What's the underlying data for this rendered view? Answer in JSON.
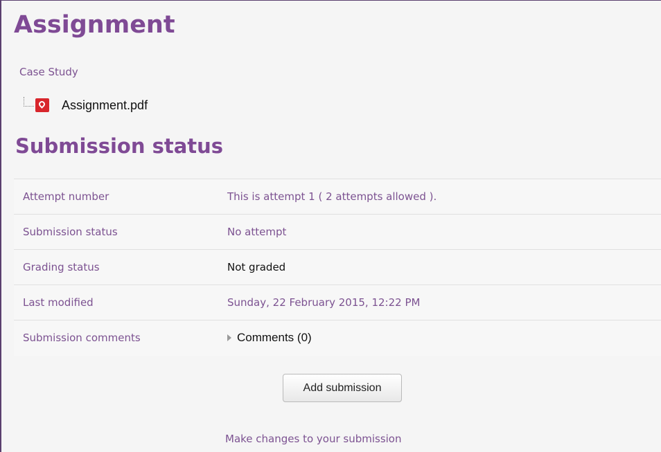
{
  "page": {
    "title": "Assignment",
    "intro": "Case Study",
    "attachment": {
      "filename": "Assignment.pdf",
      "icon": "pdf-icon"
    }
  },
  "submission_status": {
    "title": "Submission status",
    "rows": [
      {
        "label": "Attempt number",
        "value": "This is attempt 1 ( 2 attempts allowed )."
      },
      {
        "label": "Submission status",
        "value": "No attempt"
      },
      {
        "label": "Grading status",
        "value": "Not graded"
      },
      {
        "label": "Last modified",
        "value": "Sunday, 22 February 2015, 12:22 PM"
      },
      {
        "label": "Submission comments",
        "value": "Comments (0)"
      }
    ]
  },
  "actions": {
    "add_submission_label": "Add submission",
    "helper_text": "Make changes to your submission"
  },
  "colors": {
    "accent": "#7f4a95",
    "text_muted": "#7c5291",
    "pdf_red": "#d8262c"
  }
}
